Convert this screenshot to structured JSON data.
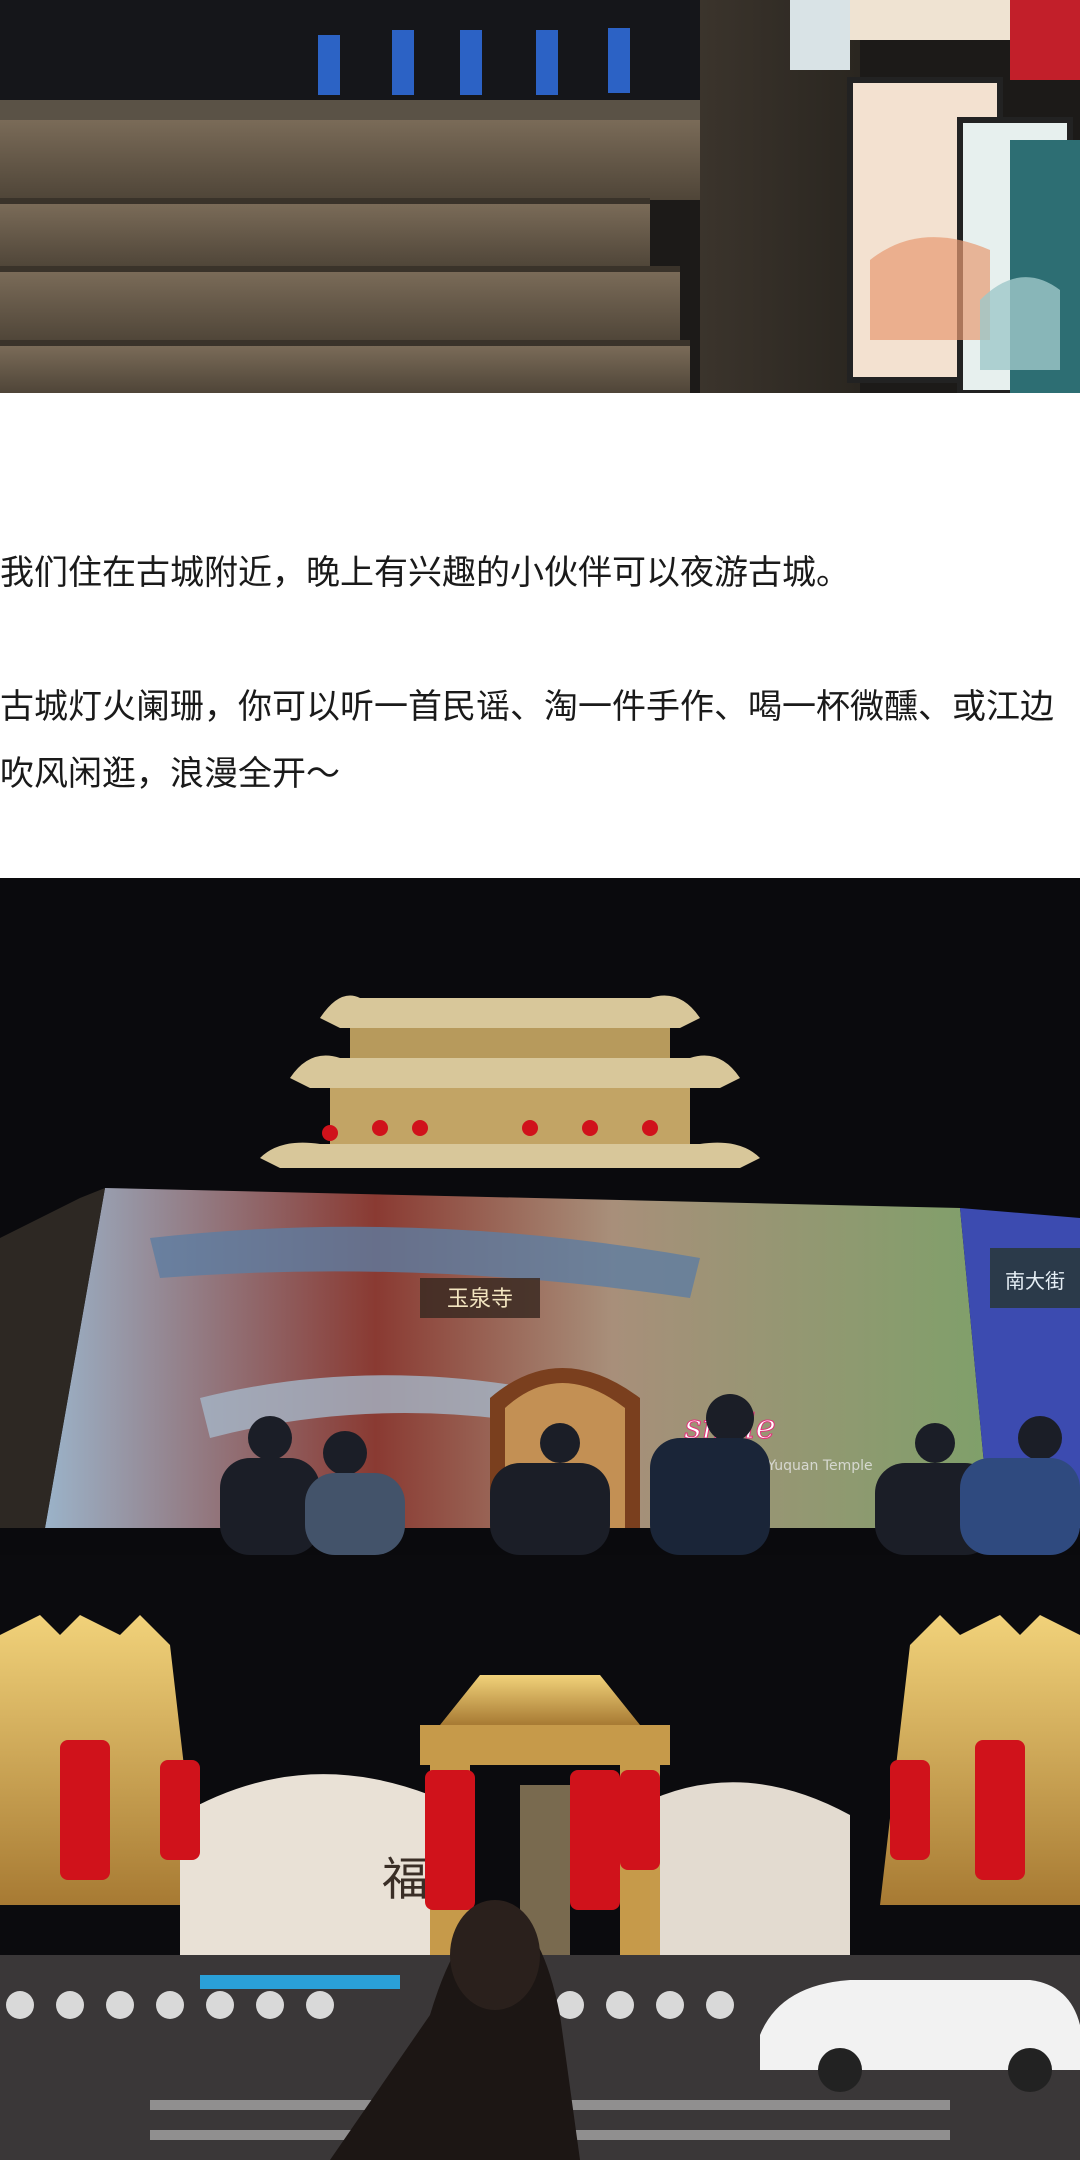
{
  "article": {
    "paragraph_1": "我们住在古城附近，晚上有兴趣的小伙伴可以夜游古城。",
    "paragraph_2": "古城灯火阑珊，你可以听一首民谣、淘一件手作、喝一杯微醺、或江边吹风闲逛，浪漫全开～"
  },
  "images": {
    "photo_1": {
      "description_icon": "stone-steps-photo"
    },
    "photo_2": {
      "overlay_text": "smile",
      "sign_text": "南大街",
      "plaque_text": "玉泉寺",
      "watermark": "Yuquan Temple"
    },
    "photo_3": {
      "wall_character": "福"
    }
  },
  "colors": {
    "text": "#1a1a1a",
    "lantern_red": "#d0121b",
    "night_sky": "#0a0a0d",
    "gold": "#e8c25a"
  }
}
